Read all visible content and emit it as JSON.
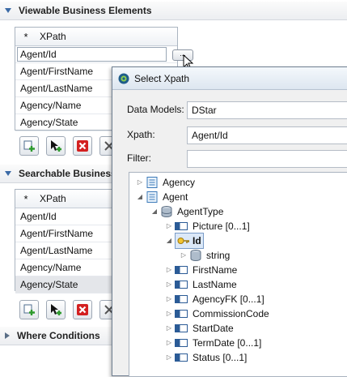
{
  "viewable": {
    "title": "Viewable Business Elements",
    "header_col": "XPath",
    "editing_value": "Agent/Id",
    "rows": [
      "Agent/FirstName",
      "Agent/LastName",
      "Agency/Name",
      "Agency/State"
    ]
  },
  "searchable": {
    "title": "Searchable Business",
    "header_col": "XPath",
    "rows": [
      "Agent/Id",
      "Agent/FirstName",
      "Agent/LastName",
      "Agency/Name",
      "Agency/State"
    ],
    "selected_index": 4
  },
  "where": {
    "title": "Where Conditions"
  },
  "dots_button": "...",
  "star_glyph": "*",
  "icons": [
    "add-row-icon",
    "add-cursor-icon",
    "delete-icon",
    "edit-icon",
    "expand-down-icon",
    "collapse-right-icon",
    "database-icon",
    "document-icon",
    "folder-icon",
    "key-icon",
    "field-icon",
    "dialog-app-icon"
  ],
  "dialog": {
    "title": "Select Xpath",
    "data_models_label": "Data Models:",
    "data_models_value": "DStar",
    "xpath_label": "Xpath:",
    "xpath_value": "Agent/Id",
    "filter_label": "Filter:",
    "filter_value": "",
    "tree": {
      "agency": "Agency",
      "agent": "Agent",
      "agent_type": "AgentType",
      "picture": "Picture  [0...1]",
      "id": "Id",
      "string": "string",
      "fields": [
        "FirstName",
        "LastName",
        "AgencyFK  [0...1]",
        "CommissionCode",
        "StartDate",
        "TermDate  [0...1]",
        "Status  [0...1]"
      ]
    }
  },
  "colors": {
    "accent": "#3b6aa6",
    "selection_bg": "#e4e6ea",
    "tree_selection_bg": "#dbe8f8"
  }
}
